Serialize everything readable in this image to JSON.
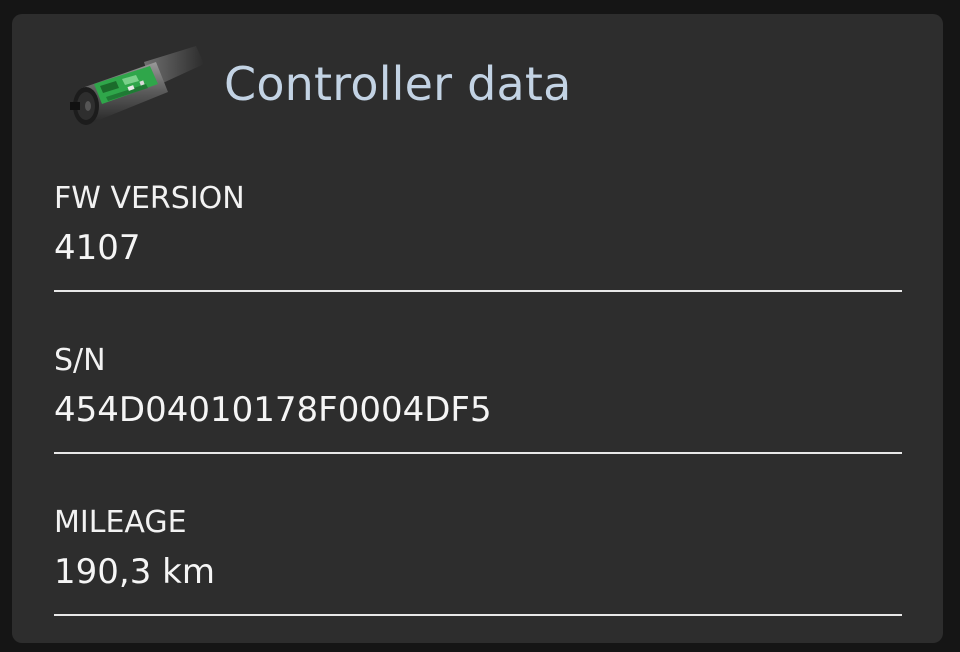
{
  "header": {
    "title": "Controller data",
    "icon": "motor-controller-icon"
  },
  "fields": [
    {
      "label": "FW VERSION",
      "value": "4107"
    },
    {
      "label": "S/N",
      "value": "454D04010178F0004DF5"
    },
    {
      "label": "MILEAGE",
      "value": "190,3 km"
    }
  ],
  "colors": {
    "background": "#151515",
    "card": "#2d2d2d",
    "title": "#c3d3e4",
    "text": "#f2f2f2",
    "divider": "#e8e8e8"
  }
}
